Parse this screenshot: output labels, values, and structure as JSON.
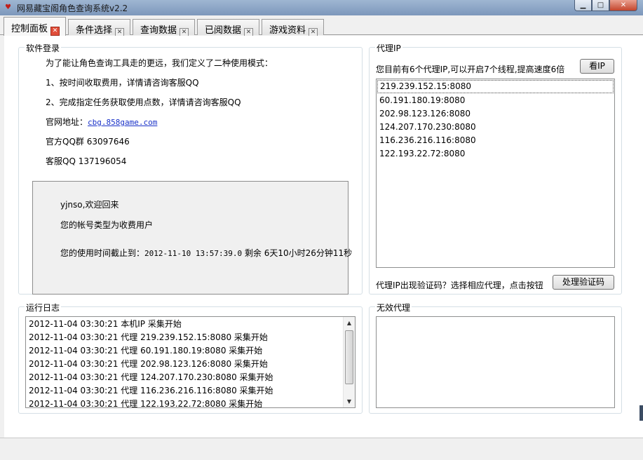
{
  "window": {
    "title": "网易藏宝阁角色查询系统v2.2",
    "min_glyph": "▁",
    "max_glyph": "□",
    "close_glyph": "✕"
  },
  "tabs": [
    {
      "label": "控制面板",
      "active": true
    },
    {
      "label": "条件选择",
      "active": false
    },
    {
      "label": "查询数据",
      "active": false
    },
    {
      "label": "已阅数据",
      "active": false
    },
    {
      "label": "游戏资料",
      "active": false
    }
  ],
  "tab_close_glyph": "✕",
  "software_login": {
    "label": "软件登录",
    "intro": "为了能让角色查询工具走的更远，我们定义了二种使用模式：",
    "mode1": "1、按时间收取费用，详情请咨询客服QQ",
    "mode2": "2、完成指定任务获取使用点数，详情请咨询客服QQ",
    "website_label": "官网地址：",
    "website_url": "cbg.858game.com",
    "qq_group": "官方QQ群 63097646",
    "support_qq": "客服QQ 137196054",
    "welcome": {
      "greeting": "yjnso,欢迎回来",
      "account_type": "您的帐号类型为收费用户",
      "expiry_label": "您的使用时间截止到：",
      "expiry_value": "2012-11-10 13:57:39.0",
      "remaining": "剩余 6天10小时26分钟11秒"
    }
  },
  "proxy_ip": {
    "label": "代理IP",
    "info": "您目前有6个代理IP,可以开启7个线程,提高速度6倍",
    "view_button": "看IP",
    "list": [
      "219.239.152.15:8080",
      "60.191.180.19:8080",
      "202.98.123.126:8080",
      "124.207.170.230:8080",
      "116.236.216.116:8080",
      "122.193.22.72:8080"
    ],
    "captcha_hint": "代理IP出现验证码？选择相应代理，点击按钮",
    "captcha_button": "处理验证码"
  },
  "run_log": {
    "label": "运行日志",
    "entries": [
      "2012-11-04 03:30:21 本机IP 采集开始",
      "2012-11-04 03:30:21 代理 219.239.152.15:8080 采集开始",
      "2012-11-04 03:30:21 代理 60.191.180.19:8080 采集开始",
      "2012-11-04 03:30:21 代理 202.98.123.126:8080 采集开始",
      "2012-11-04 03:30:21 代理 124.207.170.230:8080 采集开始",
      "2012-11-04 03:30:21 代理 116.236.216.116:8080 采集开始",
      "2012-11-04 03:30:21 代理 122.193.22.72:8080 采集开始"
    ],
    "scroll_up": "▲",
    "scroll_down": "▼"
  },
  "invalid_proxy": {
    "label": "无效代理"
  }
}
